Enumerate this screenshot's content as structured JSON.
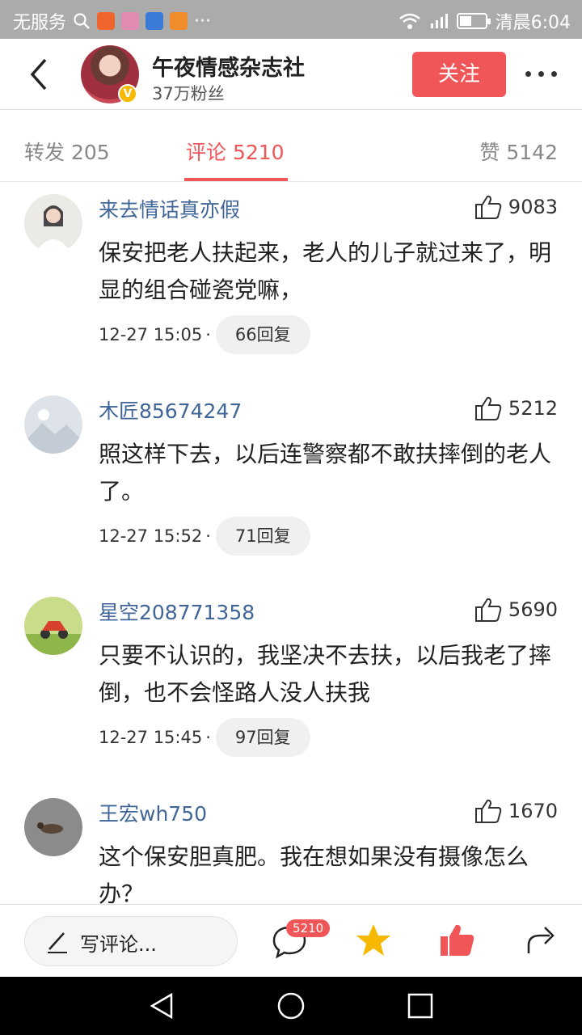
{
  "status_bar": {
    "carrier": "无服务",
    "time": "清晨6:04",
    "app_icon_colors": [
      "#f0642e",
      "#e28bb2",
      "#3b7bd8",
      "#f08c2b"
    ]
  },
  "header": {
    "account_name": "午夜情感杂志社",
    "fans": "37万粉丝",
    "follow_label": "关注",
    "verified_badge": "V"
  },
  "tabs": {
    "repost": "转发 205",
    "comments": "评论 5210",
    "likes": "赞 5142",
    "active": "comments"
  },
  "comments": [
    {
      "user": "来去情话真亦假",
      "likes": "9083",
      "text": "保安把老人扶起来，老人的儿子就过来了，明显的组合碰瓷党嘛，",
      "date": "12-27 15:05",
      "dot": "·",
      "replies": "66回复"
    },
    {
      "user": "木匠85674247",
      "likes": "5212",
      "text": "照这样下去，以后连警察都不敢扶摔倒的老人了。",
      "date": "12-27 15:52",
      "dot": "·",
      "replies": "71回复"
    },
    {
      "user": "星空208771358",
      "likes": "5690",
      "text": "只要不认识的，我坚决不去扶，以后我老了摔倒，也不会怪路人没人扶我",
      "date": "12-27 15:45",
      "dot": "·",
      "replies": "97回复"
    },
    {
      "user": "王宏wh750",
      "likes": "1670",
      "text": "这个保安胆真肥。我在想如果没有摄像怎么办？",
      "date": "",
      "dot": "",
      "replies": ""
    }
  ],
  "bottom_bar": {
    "write_placeholder": "写评论...",
    "comment_count_badge": "5210",
    "icons": [
      "comment-icon",
      "star-icon",
      "like-icon",
      "share-icon"
    ]
  },
  "colors": {
    "accent": "#f05658",
    "username": "#406599",
    "star": "#f6b800"
  }
}
